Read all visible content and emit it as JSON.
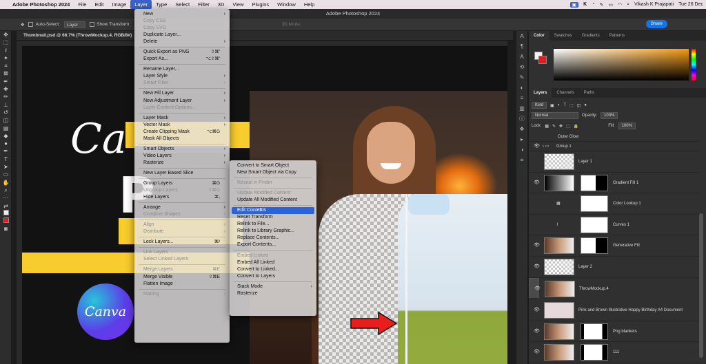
{
  "macbar": {
    "apple": "",
    "app": "Adobe Photoshop 2024",
    "menus": [
      "File",
      "Edit",
      "Image",
      "Layer",
      "Type",
      "Select",
      "Filter",
      "3D",
      "View",
      "Plugins",
      "Window",
      "Help"
    ],
    "user": "Vikash K Prajapati",
    "date": "Tue 26 Dec"
  },
  "window_title": "Adobe Photoshop 2024",
  "optbar": {
    "auto_select": "Auto-Select:",
    "layer_value": "Layer",
    "show_transform": "Show Transform",
    "mode3d": "3D Mode:"
  },
  "share_label": "Share",
  "doc_tab": "Thumbnail.psd @ 66.7% (ThrowMockup.4, RGB/8#)",
  "layer_menu": [
    {
      "label": "New",
      "arrow": true
    },
    {
      "label": "Copy CSS",
      "dis": true
    },
    {
      "label": "Copy SVG",
      "dis": true
    },
    {
      "label": "Duplicate Layer..."
    },
    {
      "label": "Delete",
      "arrow": true
    },
    {
      "sep": true
    },
    {
      "label": "Quick Export as PNG",
      "sc": "⇧⌘'"
    },
    {
      "label": "Export As...",
      "sc": "⌥⇧⌘'"
    },
    {
      "sep": true
    },
    {
      "label": "Rename Layer..."
    },
    {
      "label": "Layer Style",
      "arrow": true
    },
    {
      "label": "Smart Filter",
      "dis": true,
      "arrow": true
    },
    {
      "sep": true
    },
    {
      "label": "New Fill Layer",
      "arrow": true
    },
    {
      "label": "New Adjustment Layer",
      "arrow": true
    },
    {
      "label": "Layer Content Options...",
      "dis": true
    },
    {
      "sep": true
    },
    {
      "label": "Layer Mask",
      "arrow": true
    },
    {
      "label": "Vector Mask",
      "arrow": true
    },
    {
      "label": "Create Clipping Mask",
      "sc": "⌥⌘G"
    },
    {
      "label": "Mask All Objects"
    },
    {
      "sep": true
    },
    {
      "label": "Smart Objects",
      "arrow": true,
      "hl": true
    },
    {
      "label": "Video Layers",
      "arrow": true
    },
    {
      "label": "Rasterize",
      "arrow": true
    },
    {
      "sep": true
    },
    {
      "label": "New Layer Based Slice"
    },
    {
      "sep": true
    },
    {
      "label": "Group Layers",
      "sc": "⌘G"
    },
    {
      "label": "Ungroup Layers",
      "sc": "⇧⌘G",
      "dis": true
    },
    {
      "label": "Hide Layers",
      "sc": "⌘,"
    },
    {
      "sep": true
    },
    {
      "label": "Arrange",
      "arrow": true
    },
    {
      "label": "Combine Shapes",
      "dis": true,
      "arrow": true
    },
    {
      "sep": true
    },
    {
      "label": "Align",
      "dis": true,
      "arrow": true
    },
    {
      "label": "Distribute",
      "dis": true,
      "arrow": true
    },
    {
      "sep": true
    },
    {
      "label": "Lock Layers...",
      "sc": "⌘/"
    },
    {
      "sep": true
    },
    {
      "label": "Link Layers",
      "dis": true
    },
    {
      "label": "Select Linked Layers",
      "dis": true
    },
    {
      "sep": true
    },
    {
      "label": "Merge Layers",
      "sc": "⌘E",
      "dis": true
    },
    {
      "label": "Merge Visible",
      "sc": "⇧⌘E"
    },
    {
      "label": "Flatten Image"
    },
    {
      "sep": true
    },
    {
      "label": "Matting",
      "dis": true,
      "arrow": true
    }
  ],
  "smart_menu": [
    {
      "label": "Convert to Smart Object"
    },
    {
      "label": "New Smart Object via Copy"
    },
    {
      "sep": true
    },
    {
      "label": "Reveal in Finder",
      "dis": true
    },
    {
      "sep": true
    },
    {
      "label": "Update Modified Content",
      "dis": true
    },
    {
      "label": "Update All Modified Content"
    },
    {
      "sep": true
    },
    {
      "label": "Edit Contents",
      "sel": true
    },
    {
      "label": "Reset Transform"
    },
    {
      "label": "Relink to File..."
    },
    {
      "label": "Relink to Library Graphic..."
    },
    {
      "label": "Replace Contents..."
    },
    {
      "label": "Export Contents..."
    },
    {
      "sep": true
    },
    {
      "label": "Embed Linked",
      "dis": true
    },
    {
      "label": "Embed All Linked"
    },
    {
      "label": "Convert to Linked..."
    },
    {
      "label": "Convert to Layers"
    },
    {
      "sep": true
    },
    {
      "label": "Stack Mode",
      "arrow": true
    },
    {
      "label": "Rasterize"
    }
  ],
  "panels": {
    "color_tabs": [
      "Color",
      "Swatches",
      "Gradients",
      "Patterns"
    ],
    "layer_tabs": [
      "Layers",
      "Channels",
      "Paths"
    ],
    "kind": "Kind",
    "blend": "Normal",
    "opacity_label": "Opacity:",
    "opacity": "100%",
    "lock_label": "Lock:",
    "fill_label": "Fill:",
    "fill": "100%"
  },
  "layers": [
    {
      "name": "Outer Glow",
      "type": "fx"
    },
    {
      "name": "Group 1",
      "type": "group",
      "eye": true
    },
    {
      "name": "Layer 1",
      "type": "big",
      "thumb": "chk"
    },
    {
      "name": "Gradient Fill 1",
      "type": "big",
      "eye": true,
      "thumb": "grad",
      "mask": "half"
    },
    {
      "name": "Color Lookup 1",
      "type": "big",
      "thumb": "none",
      "icon": "▦",
      "mask": "plain"
    },
    {
      "name": "Curves 1",
      "type": "big",
      "thumb": "none",
      "icon": "⌇",
      "mask": "plain"
    },
    {
      "name": "Generative Fill",
      "type": "big",
      "eye": true,
      "thumb": "photo",
      "mask": "half"
    },
    {
      "name": "Layer 2",
      "type": "big",
      "eye": true,
      "thumb": "chk"
    },
    {
      "name": "ThrowMockup.4",
      "type": "big",
      "eye": true,
      "thumb": "photo",
      "sel": true
    },
    {
      "name": "Pink and Brown Illustrative Happy Birthday A4 Document",
      "type": "big",
      "eye": true,
      "thumb": "pink"
    },
    {
      "name": "Png blankets",
      "type": "big",
      "eye": true,
      "thumb": "photo",
      "mask": "bk"
    },
    {
      "name": "111",
      "type": "big",
      "eye": true,
      "thumb": "photo",
      "mask": "bk"
    }
  ],
  "artboard": {
    "canva_logo": "Canva"
  }
}
